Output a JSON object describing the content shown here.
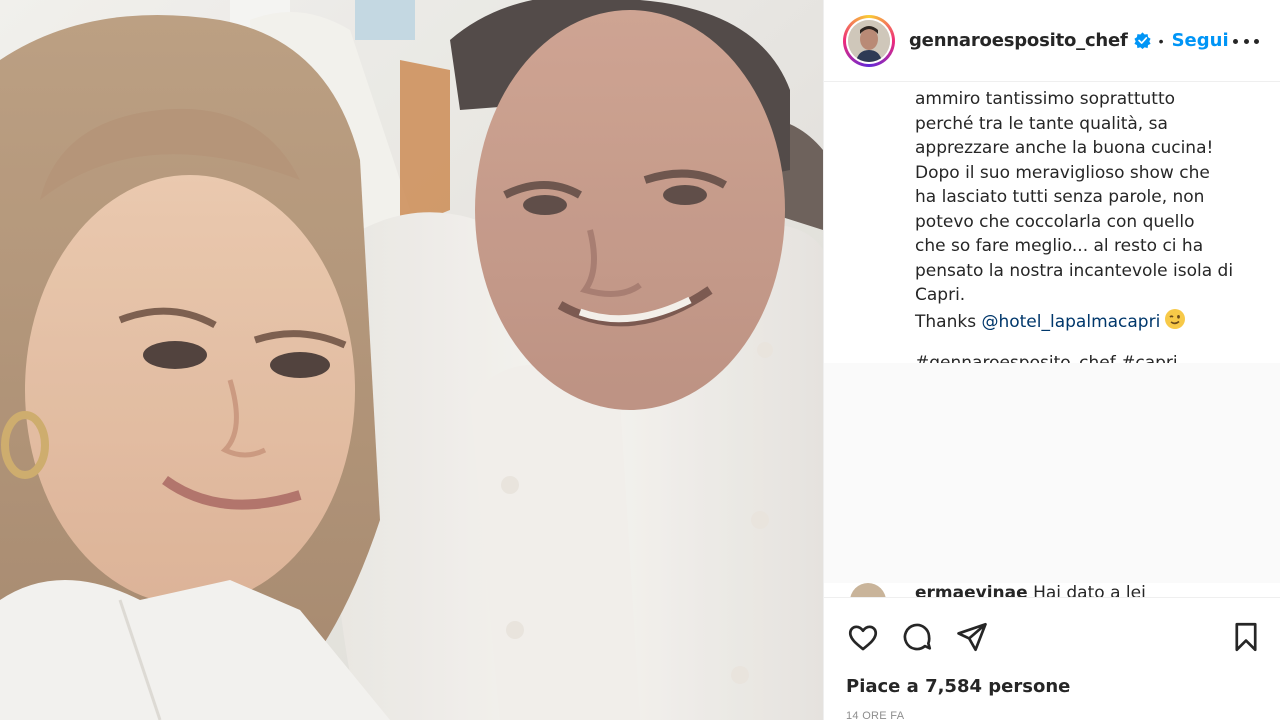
{
  "post": {
    "username": "gennaroesposito_chef",
    "follow_label": "Segui",
    "separator": "•",
    "caption_lines": [
      "ammiro tantissimo soprattutto",
      "perché tra le tante qualità, sa",
      "apprezzare anche la buona cucina!",
      "Dopo il suo meraviglioso show che",
      "ha lasciato tutti senza parole, non",
      "potevo che coccolarla con quello",
      "che so fare meglio... al resto ci ha",
      "pensato la nostra incantevole isola di",
      "Capri."
    ],
    "thanks_prefix": "Thanks ",
    "thanks_mention": "@hotel_lapalmacapri",
    "hashtag_peek": "#gennaroesposito_chef #capri",
    "comment_user": "ermaevinae",
    "comment_text": "Hai dato a lei",
    "likes": "Piace a 7,584 persone",
    "time_ago": "14 ORE FA"
  },
  "icons": {
    "verified": "verified-badge-icon",
    "more": "more-options-icon",
    "like": "heart-icon",
    "comment": "comment-icon",
    "share": "paper-plane-icon",
    "save": "bookmark-icon",
    "emoji": "winking-face-icon"
  },
  "colors": {
    "link": "#0095f6",
    "mention": "#00376b",
    "text": "#262626",
    "muted": "#8e8e8e"
  }
}
